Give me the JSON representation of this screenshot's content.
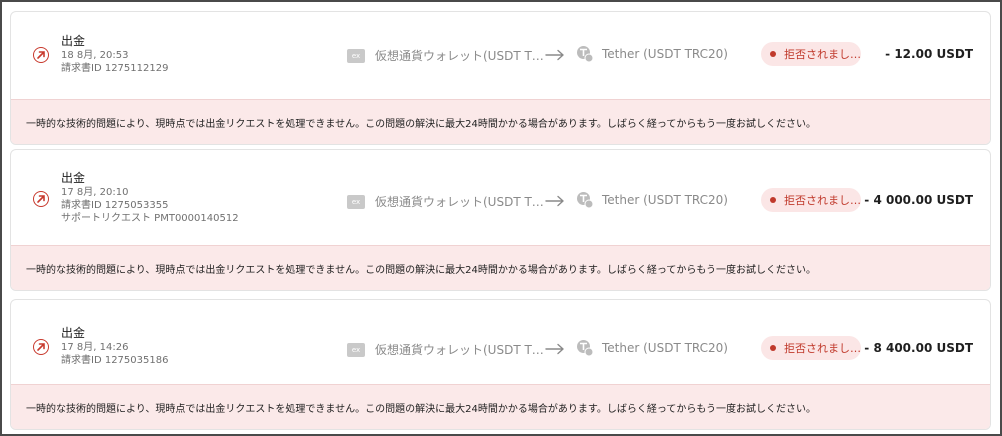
{
  "transactions": [
    {
      "type": "出金",
      "datetime": "18 8月, 20:53",
      "invoice": "請求書ID 1275112129",
      "support": "",
      "source_badge": "ex",
      "source_wallet": "仮想通貨ウォレット(USDT T…",
      "destination": "Tether (USDT TRC20)",
      "status": "拒否されまし…",
      "amount": "- 12.00 USDT",
      "error": "一時的な技術的問題により、現時点では出金リクエストを処理できません。この問題の解決に最大24時間かかる場合があります。しばらく経ってからもう一度お試しください。"
    },
    {
      "type": "出金",
      "datetime": "17 8月, 20:10",
      "invoice": "請求書ID 1275053355",
      "support": "サポートリクエスト PMT0000140512",
      "source_badge": "ex",
      "source_wallet": "仮想通貨ウォレット(USDT T…",
      "destination": "Tether (USDT TRC20)",
      "status": "拒否されまし…",
      "amount": "- 4 000.00 USDT",
      "error": "一時的な技術的問題により、現時点では出金リクエストを処理できません。この問題の解決に最大24時間かかる場合があります。しばらく経ってからもう一度お試しください。"
    },
    {
      "type": "出金",
      "datetime": "17 8月, 14:26",
      "invoice": "請求書ID 1275035186",
      "support": "",
      "source_badge": "ex",
      "source_wallet": "仮想通貨ウォレット(USDT T…",
      "destination": "Tether (USDT TRC20)",
      "status": "拒否されまし…",
      "amount": "- 8 400.00 USDT",
      "error": "一時的な技術的問題により、現時点では出金リクエストを処理できません。この問題の解決に最大24時間かかる場合があります。しばらく経ってからもう一度お試しください。"
    }
  ],
  "icons": {
    "withdrawal": "arrow-up-right-circle-icon",
    "transfer": "arrow-right-icon",
    "tether": "tether-coin-icon"
  },
  "colors": {
    "status_rejected": "#c0392b",
    "error_background": "#fbe9e9",
    "status_background": "#fbe6e6"
  }
}
